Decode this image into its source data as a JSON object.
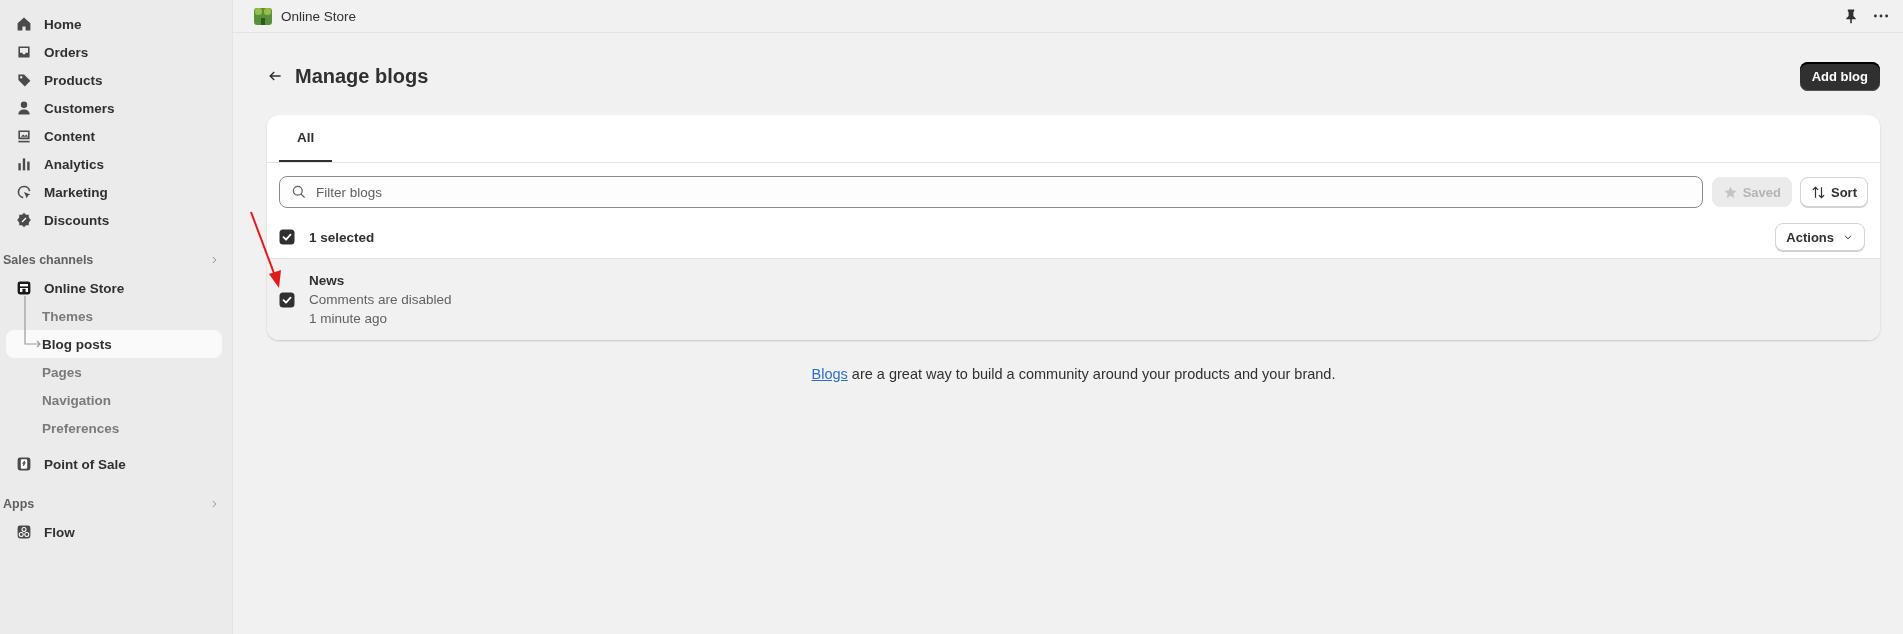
{
  "sidebar": {
    "items": [
      {
        "label": "Home",
        "selected": false
      },
      {
        "label": "Orders",
        "selected": false
      },
      {
        "label": "Products",
        "selected": false
      },
      {
        "label": "Customers",
        "selected": false
      },
      {
        "label": "Content",
        "selected": false
      },
      {
        "label": "Analytics",
        "selected": false
      },
      {
        "label": "Marketing",
        "selected": false
      },
      {
        "label": "Discounts",
        "selected": false
      }
    ],
    "sections": [
      {
        "title": "Sales channels",
        "items": [
          {
            "label": "Online Store",
            "selected": false,
            "children": [
              {
                "label": "Themes",
                "selected": false
              },
              {
                "label": "Blog posts",
                "selected": true
              },
              {
                "label": "Pages",
                "selected": false
              },
              {
                "label": "Navigation",
                "selected": false
              },
              {
                "label": "Preferences",
                "selected": false
              }
            ]
          },
          {
            "label": "Point of Sale",
            "selected": false
          }
        ]
      },
      {
        "title": "Apps",
        "items": [
          {
            "label": "Flow",
            "selected": false
          }
        ]
      }
    ]
  },
  "app_bar": {
    "title": "Online Store"
  },
  "page": {
    "title": "Manage blogs",
    "primary_action": "Add blog"
  },
  "card": {
    "tabs": [
      {
        "label": "All",
        "selected": true
      }
    ],
    "filter": {
      "placeholder": "Filter blogs"
    },
    "saved_button": {
      "label": "Saved",
      "disabled": true
    },
    "sort_button": {
      "label": "Sort"
    },
    "bulk": {
      "checked": true,
      "label": "1 selected",
      "action": "Actions"
    },
    "rows": [
      {
        "title": "News",
        "comments": "Comments are disabled",
        "updated": "1 minute ago",
        "selected": true
      }
    ]
  },
  "footer": {
    "link": "Blogs",
    "text": "are a great way to build a community around your products and your brand."
  },
  "annotations": [
    {
      "kind": "arrow"
    }
  ]
}
